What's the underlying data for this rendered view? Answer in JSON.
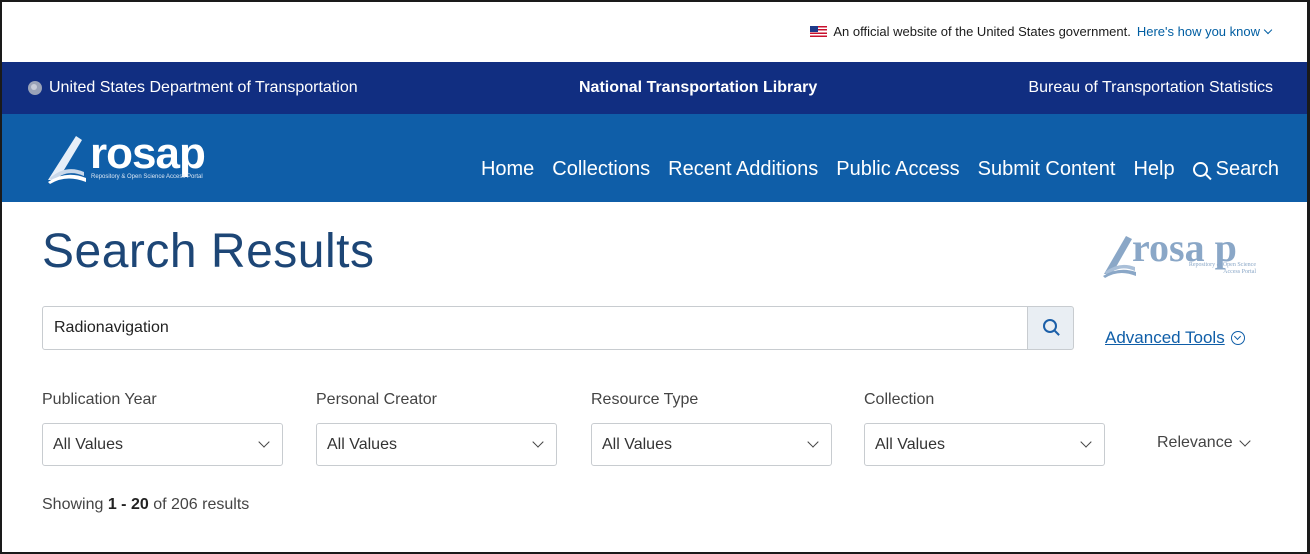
{
  "gov_banner": {
    "text": "An official website of the United States government.",
    "link": "Here's how you know"
  },
  "dot_bar": {
    "left": "United States Department of Transportation",
    "center": "National Transportation Library",
    "right": "Bureau of Transportation Statistics"
  },
  "header": {
    "logo_text": "rosap",
    "logo_sub": "Repository & Open Science Access Portal",
    "nav": [
      "Home",
      "Collections",
      "Recent Additions",
      "Public Access",
      "Submit Content",
      "Help"
    ],
    "search_label": "Search"
  },
  "main": {
    "title": "Search Results",
    "side_logo_text": "rosa p",
    "side_logo_sub": "Repository & Open Science Access Portal",
    "search_value": "Radionavigation",
    "advanced_tools": "Advanced Tools",
    "filters": [
      {
        "label": "Publication Year",
        "value": "All Values"
      },
      {
        "label": "Personal Creator",
        "value": "All Values"
      },
      {
        "label": "Resource Type",
        "value": "All Values"
      },
      {
        "label": "Collection",
        "value": "All Values"
      }
    ],
    "sort": "Relevance",
    "results": {
      "prefix": "Showing",
      "range": "1 - 20",
      "middle": "of",
      "total": "206",
      "suffix": "results"
    }
  },
  "colors": {
    "dot_bar": "#112e81",
    "rosap_bar": "#0f5ea8",
    "title": "#1d4676",
    "link": "#0f5ea8"
  }
}
